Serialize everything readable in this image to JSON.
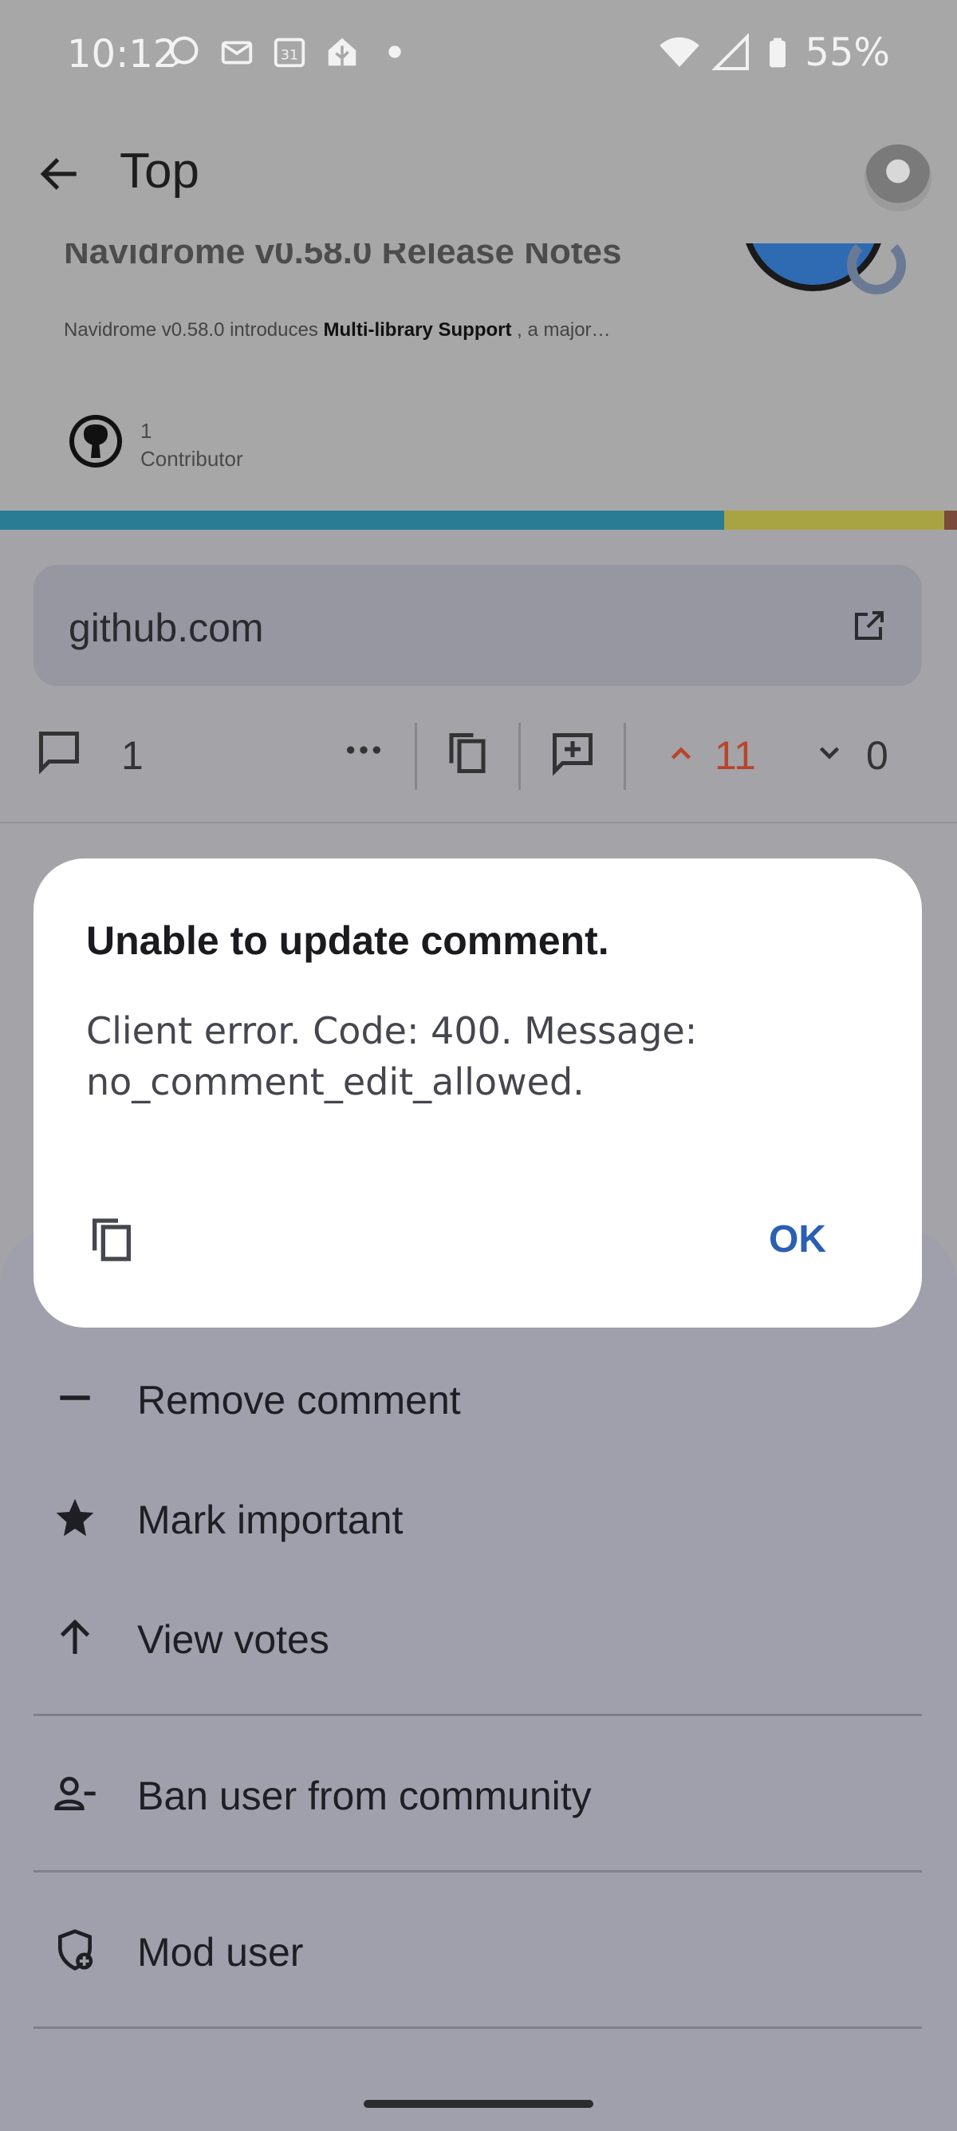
{
  "status_bar": {
    "time": "10:12",
    "battery_percent": "55%",
    "notification_icons": [
      "chat-bubble-icon",
      "mail-icon",
      "calendar-31-icon",
      "home-assistant-icon",
      "dot-icon"
    ],
    "calendar_day": "31"
  },
  "top_bar": {
    "title": "Top"
  },
  "post_card": {
    "title": "Navidrome v0.58.0 Release Notes",
    "description_prefix": "Navidrome v0.58.0 introduces ",
    "description_bold": "Multi-library Support",
    "description_suffix": " , a major…",
    "contributor_count": "1",
    "contributor_label": "Contributor"
  },
  "link": {
    "domain": "github.com"
  },
  "actions": {
    "comment_count": "1",
    "upvotes": "11",
    "downvotes": "0"
  },
  "bottom_sheet": {
    "items": [
      {
        "label": "Remove comment",
        "icon": "minus-icon"
      },
      {
        "label": "Mark important",
        "icon": "star-icon"
      },
      {
        "label": "View votes",
        "icon": "arrow-up-icon"
      },
      {
        "label": "Ban user from community",
        "icon": "person-remove-icon"
      },
      {
        "label": "Mod user",
        "icon": "shield-add-icon"
      }
    ]
  },
  "dialog": {
    "title": "Unable to update comment.",
    "message": "Client error. Code: 400. Message: no_comment_edit_allowed.",
    "ok_label": "OK"
  },
  "colors": {
    "upvote": "#b8452a",
    "dialog_accent": "#2b5fb3",
    "scrim": "#a3a3a8"
  }
}
